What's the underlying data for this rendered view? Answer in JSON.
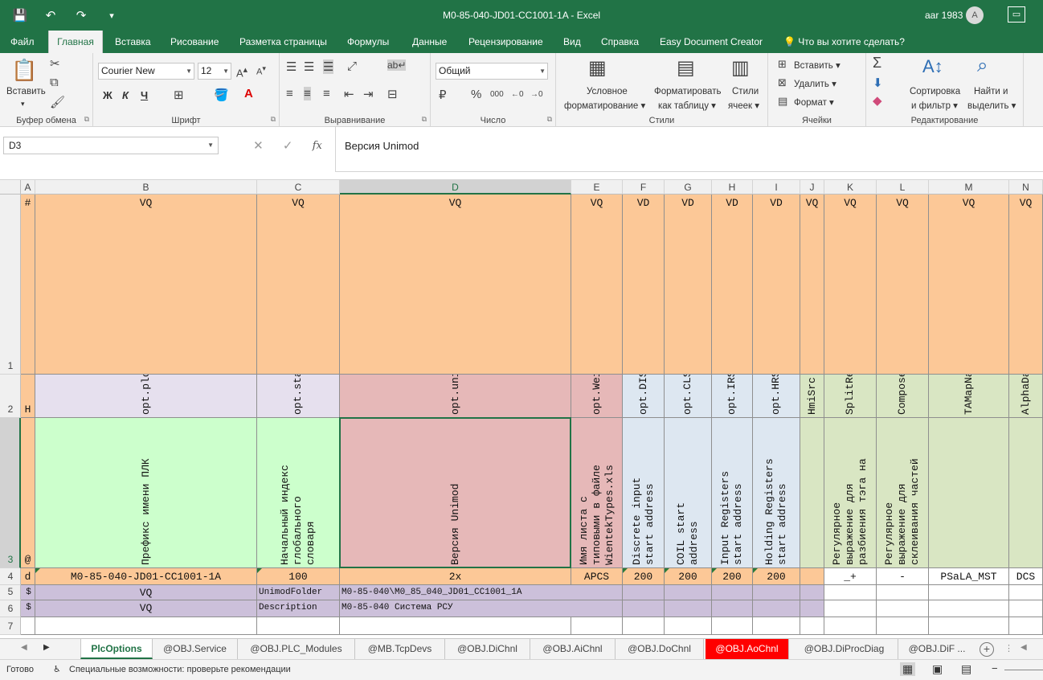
{
  "window": {
    "title": "M0-85-040-JD01-CC1001-1A  -  Excel",
    "user": "aar 1983",
    "avatar_letter": "A"
  },
  "qat": {
    "save": "💾",
    "undo": "↶",
    "redo": "↷",
    "customize": "▾"
  },
  "tabs": [
    {
      "label": "Файл"
    },
    {
      "label": "Главная"
    },
    {
      "label": "Вставка"
    },
    {
      "label": "Рисование"
    },
    {
      "label": "Разметка страницы"
    },
    {
      "label": "Формулы"
    },
    {
      "label": "Данные"
    },
    {
      "label": "Рецензирование"
    },
    {
      "label": "Вид"
    },
    {
      "label": "Справка"
    },
    {
      "label": "Easy Document Creator"
    }
  ],
  "tell_me": "Что вы хотите сделать?",
  "ribbon": {
    "clipboard": {
      "label": "Буфер обмена",
      "paste": "Вставить"
    },
    "font": {
      "label": "Шрифт",
      "name": "Courier New",
      "size": "12",
      "bold": "Ж",
      "italic": "К",
      "underline": "Ч"
    },
    "alignment": {
      "label": "Выравнивание"
    },
    "number": {
      "label": "Число",
      "format": "Общий"
    },
    "styles": {
      "label": "Стили",
      "conditional": [
        "Условное",
        "форматирование ▾"
      ],
      "format_table": [
        "Форматировать",
        "как таблицу ▾"
      ],
      "cell_styles": [
        "Стили",
        "ячеек ▾"
      ]
    },
    "cells": {
      "label": "Ячейки",
      "insert": "Вставить ▾",
      "delete": "Удалить ▾",
      "format": "Формат ▾"
    },
    "editing": {
      "label": "Редактирование",
      "sort": [
        "Сортировка",
        "и фильтр ▾"
      ],
      "find": [
        "Найти и",
        "выделить ▾"
      ]
    }
  },
  "formula_bar": {
    "name_box": "D3",
    "formula": "Версия Unimod",
    "fx": "fx"
  },
  "columns": [
    {
      "letter": "A"
    },
    {
      "letter": "B"
    },
    {
      "letter": "C"
    },
    {
      "letter": "D"
    },
    {
      "letter": "E"
    },
    {
      "letter": "F"
    },
    {
      "letter": "G"
    },
    {
      "letter": "H"
    },
    {
      "letter": "I"
    },
    {
      "letter": "J"
    },
    {
      "letter": "K"
    },
    {
      "letter": "L"
    },
    {
      "letter": "M"
    },
    {
      "letter": "N"
    }
  ],
  "rows": [
    "1",
    "2",
    "3",
    "4",
    "5",
    "6",
    "7"
  ],
  "row1": [
    "#",
    "VQ",
    "VQ",
    "VQ",
    "VQ",
    "VD",
    "VD",
    "VD",
    "VD",
    "VQ",
    "VQ",
    "VQ",
    "VQ",
    "VQ"
  ],
  "row2": [
    "H",
    "opt.plcName",
    "opt.startIndex",
    "opt.unimod",
    "opt.WeintekTypesPath",
    "opt.DIStartAddr",
    "opt.CLStartAddr",
    "opt.IRStartAddr",
    "opt.HRStartAddr",
    "HmiSrc",
    "SplitRegex",
    "ComposeRegex",
    "TAMapName",
    "AlphaDataCategory"
  ],
  "row3": [
    "@",
    "Префикс имени ПЛК",
    "Начальный индекс\nглобального\nсловаря",
    "Версия Unimod",
    "Имя листа с\nтиповыми в файле\nWientekTypes.xls",
    "Discrete input\nstart address",
    "COIL start\naddress",
    "Input Registers\nstart address",
    "Holding Registers\nstart address",
    "",
    "Регулярное\nвыражение для\nразбиения тэга на",
    "Регулярное\nвыражение для\nсклеивания частей",
    "",
    ""
  ],
  "row4": [
    "d",
    "M0-85-040-JD01-CC1001-1A",
    "100",
    "2x",
    "APCS",
    "200",
    "200",
    "200",
    "200",
    "",
    "_+",
    "-",
    "PSaLA_MST",
    "DCS"
  ],
  "row5": {
    "a": "$",
    "b": "VQ",
    "c": "UnimodFolder",
    "d": "M0-85-040\\M0_85_040_JD01_CC1001_1A"
  },
  "row6": {
    "a": "$",
    "b": "VQ",
    "c": "Description",
    "d": "M0-85-040 Система РСУ"
  },
  "sheets": [
    {
      "label": "PlcOptions"
    },
    {
      "label": "@OBJ.Service"
    },
    {
      "label": "@OBJ.PLC_Modules"
    },
    {
      "label": "@MB.TcpDevs"
    },
    {
      "label": "@OBJ.DiChnl"
    },
    {
      "label": "@OBJ.AiChnl"
    },
    {
      "label": "@OBJ.DoChnl"
    },
    {
      "label": "@OBJ.AoChnl"
    },
    {
      "label": "@OBJ.DiProcDiag"
    },
    {
      "label": "@OBJ.DiF ..."
    }
  ],
  "status": {
    "ready": "Готово",
    "accessibility": "Специальные возможности: проверьте рекомендации"
  },
  "colors": {
    "excel_green": "#217346",
    "header_orange": "#fcc897",
    "lavender": "#e6e0ee",
    "pink": "#e6b8b8",
    "light_green": "#ccffcc",
    "light_blue": "#dde7f1",
    "olive_green": "#d9e6c3",
    "purple": "#ccc0da",
    "sheet_red": "#ff0000"
  }
}
